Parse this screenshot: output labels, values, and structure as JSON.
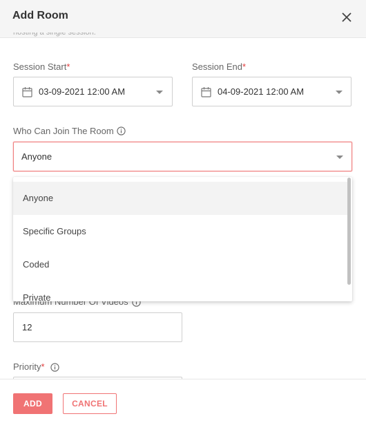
{
  "dialog": {
    "title": "Add Room",
    "partial_hint": "hosting a single session."
  },
  "session_start": {
    "label": "Session Start",
    "required_mark": "*",
    "value": "03-09-2021 12:00 AM"
  },
  "session_end": {
    "label": "Session End",
    "required_mark": "*",
    "value": "04-09-2021 12:00 AM"
  },
  "who_can_join": {
    "label": "Who Can Join The Room",
    "value": "Anyone",
    "options": [
      "Anyone",
      "Specific Groups",
      "Coded",
      "Private"
    ],
    "selected_index": 0
  },
  "max_videos": {
    "label": "Maximum Number Of Videos",
    "value": "12"
  },
  "priority": {
    "label": "Priority",
    "required_mark": "*"
  },
  "footer": {
    "add_label": "ADD",
    "cancel_label": "CANCEL"
  },
  "colors": {
    "accent": "#f07374",
    "required": "#e23b3b",
    "focus_border": "#f08080"
  },
  "icons": [
    "close-icon",
    "calendar-icon",
    "info-icon",
    "caret-down-icon"
  ]
}
